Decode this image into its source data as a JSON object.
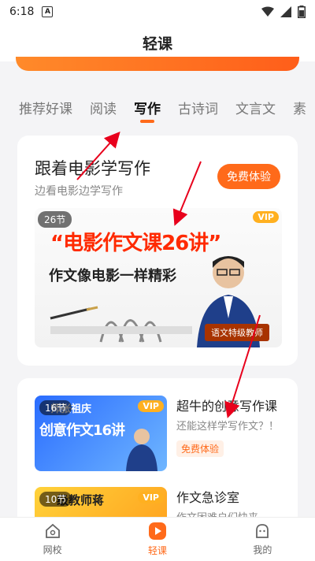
{
  "status_bar": {
    "time": "6:18",
    "a_label": "A"
  },
  "header": {
    "title": "轻课"
  },
  "tabs": [
    {
      "label": "推荐好课",
      "active": false
    },
    {
      "label": "阅读",
      "active": false
    },
    {
      "label": "写作",
      "active": true
    },
    {
      "label": "古诗词",
      "active": false
    },
    {
      "label": "文言文",
      "active": false
    },
    {
      "label": "素",
      "active": false
    }
  ],
  "featured": {
    "title": "跟着电影学写作",
    "subtitle": "边看电影边学写作",
    "free_button": "免费体验",
    "poster": {
      "count_badge": "26节",
      "vip": "VIP",
      "big_title": "“电影作文课26讲”",
      "sub_line": "作文像电影一样精彩",
      "teacher_tag": "语文特级教师"
    }
  },
  "courses": [
    {
      "count_badge": "16节",
      "vip": "VIP",
      "thumb_text": "创意作文16讲",
      "thumb_top": "师张祖庆",
      "title": "超牛的创意写作课",
      "desc": "还能这样学写作文？！",
      "tag": "免费体验"
    },
    {
      "count_badge": "10节",
      "vip": "VIP",
      "thumb_text": "级教师蒋",
      "title": "作文急诊室",
      "desc": "作文困难户们快来",
      "tag": ""
    }
  ],
  "bottom_nav": [
    {
      "label": "网校",
      "active": false
    },
    {
      "label": "轻课",
      "active": true
    },
    {
      "label": "我的",
      "active": false
    }
  ],
  "colors": {
    "accent": "#ff6a1a",
    "annotation_arrow": "#e8001c"
  }
}
